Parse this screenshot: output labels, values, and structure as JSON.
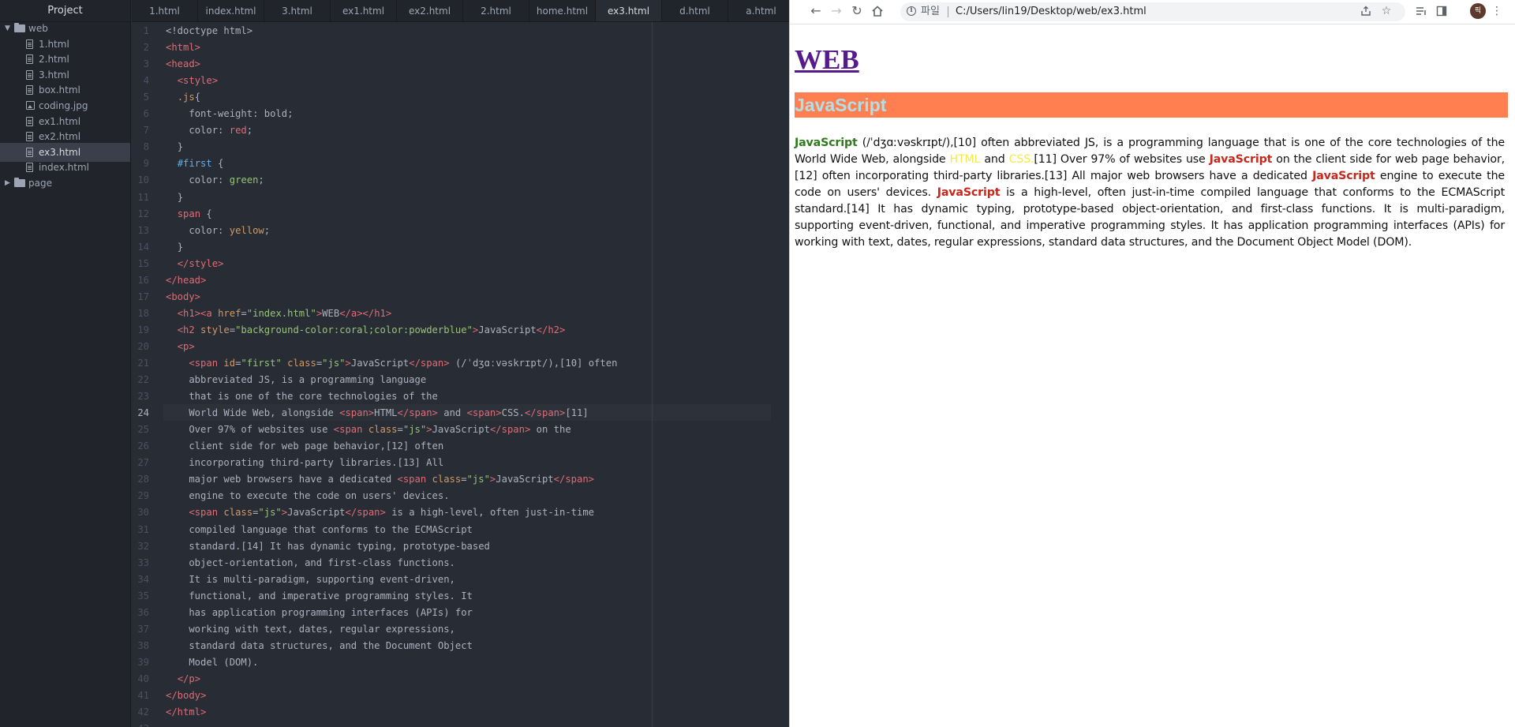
{
  "editor": {
    "project_title": "Project",
    "tree": [
      {
        "kind": "folder",
        "open": true,
        "label": "web",
        "depth": 0
      },
      {
        "kind": "file",
        "label": "1.html",
        "depth": 1
      },
      {
        "kind": "file",
        "label": "2.html",
        "depth": 1
      },
      {
        "kind": "file",
        "label": "3.html",
        "depth": 1
      },
      {
        "kind": "file",
        "label": "box.html",
        "depth": 1
      },
      {
        "kind": "image",
        "label": "coding.jpg",
        "depth": 1
      },
      {
        "kind": "file",
        "label": "ex1.html",
        "depth": 1
      },
      {
        "kind": "file",
        "label": "ex2.html",
        "depth": 1
      },
      {
        "kind": "file",
        "label": "ex3.html",
        "depth": 1,
        "selected": true
      },
      {
        "kind": "file",
        "label": "index.html",
        "depth": 1
      },
      {
        "kind": "folder",
        "open": false,
        "label": "page",
        "depth": 0
      }
    ],
    "tabs": [
      {
        "label": "1.html"
      },
      {
        "label": "index.html"
      },
      {
        "label": "3.html"
      },
      {
        "label": "ex1.html"
      },
      {
        "label": "ex2.html"
      },
      {
        "label": "2.html"
      },
      {
        "label": "home.html"
      },
      {
        "label": "ex3.html",
        "active": true
      },
      {
        "label": "d.html"
      },
      {
        "label": "a.html"
      }
    ],
    "current_line": 24,
    "code_lines": [
      [
        [
          "t-text",
          "<!doctype html>"
        ]
      ],
      [
        [
          "t-tag",
          "<html>"
        ]
      ],
      [
        [
          "t-tag",
          "<head>"
        ]
      ],
      [
        [
          "t-text",
          "  "
        ],
        [
          "t-tag",
          "<style>"
        ]
      ],
      [
        [
          "t-text",
          "  "
        ],
        [
          "t-sel",
          ".js"
        ],
        [
          "t-punct",
          "{"
        ]
      ],
      [
        [
          "t-text",
          "    "
        ],
        [
          "t-prop",
          "font-weight: bold;"
        ]
      ],
      [
        [
          "t-text",
          "    "
        ],
        [
          "t-prop",
          "color: "
        ],
        [
          "t-val",
          "red"
        ],
        [
          "t-punct",
          ";"
        ]
      ],
      [
        [
          "t-text",
          "  "
        ],
        [
          "t-punct",
          "}"
        ]
      ],
      [
        [
          "t-text",
          "  "
        ],
        [
          "t-id",
          "#first"
        ],
        [
          "t-punct",
          " {"
        ]
      ],
      [
        [
          "t-text",
          "    "
        ],
        [
          "t-prop",
          "color: "
        ],
        [
          "t-str",
          "green"
        ],
        [
          "t-punct",
          ";"
        ]
      ],
      [
        [
          "t-text",
          "  "
        ],
        [
          "t-punct",
          "}"
        ]
      ],
      [
        [
          "t-text",
          "  "
        ],
        [
          "t-tag",
          "span"
        ],
        [
          "t-punct",
          " {"
        ]
      ],
      [
        [
          "t-text",
          "    "
        ],
        [
          "t-prop",
          "color: "
        ],
        [
          "t-attr",
          "yellow"
        ],
        [
          "t-punct",
          ";"
        ]
      ],
      [
        [
          "t-text",
          "  "
        ],
        [
          "t-punct",
          "}"
        ]
      ],
      [
        [
          "t-text",
          "  "
        ],
        [
          "t-tag",
          "</style>"
        ]
      ],
      [
        [
          "t-tag",
          "</head>"
        ]
      ],
      [
        [
          "t-tag",
          "<body>"
        ]
      ],
      [
        [
          "t-text",
          "  "
        ],
        [
          "t-tag",
          "<h1><a "
        ],
        [
          "t-attr",
          "href"
        ],
        [
          "t-punct",
          "="
        ],
        [
          "t-str",
          "\"index.html\""
        ],
        [
          "t-tag",
          ">"
        ],
        [
          "t-text",
          "WEB"
        ],
        [
          "t-tag",
          "</a></h1>"
        ]
      ],
      [
        [
          "t-text",
          "  "
        ],
        [
          "t-tag",
          "<h2 "
        ],
        [
          "t-attr",
          "style"
        ],
        [
          "t-punct",
          "="
        ],
        [
          "t-str",
          "\"background-color:coral;color:powderblue\""
        ],
        [
          "t-tag",
          ">"
        ],
        [
          "t-text",
          "JavaScript"
        ],
        [
          "t-tag",
          "</h2>"
        ]
      ],
      [
        [
          "t-text",
          "  "
        ],
        [
          "t-tag",
          "<p>"
        ]
      ],
      [
        [
          "t-text",
          "    "
        ],
        [
          "t-tag",
          "<span "
        ],
        [
          "t-attr",
          "id"
        ],
        [
          "t-punct",
          "="
        ],
        [
          "t-str",
          "\"first\""
        ],
        [
          "t-attr",
          " class"
        ],
        [
          "t-punct",
          "="
        ],
        [
          "t-str",
          "\"js\""
        ],
        [
          "t-tag",
          ">"
        ],
        [
          "t-text",
          "JavaScript"
        ],
        [
          "t-tag",
          "</span>"
        ],
        [
          "t-text",
          " (/ˈdʒɑːvəskrɪpt/),[10] often"
        ]
      ],
      [
        [
          "t-text",
          "    abbreviated JS, is a programming language"
        ]
      ],
      [
        [
          "t-text",
          "    that is one of the core technologies of the"
        ]
      ],
      [
        [
          "t-text",
          "    World Wide Web, alongside "
        ],
        [
          "t-tag",
          "<span>"
        ],
        [
          "t-text",
          "HTML"
        ],
        [
          "t-tag",
          "</span>"
        ],
        [
          "t-text",
          " and "
        ],
        [
          "t-tag",
          "<span>"
        ],
        [
          "t-text",
          "CSS."
        ],
        [
          "t-tag",
          "</span>"
        ],
        [
          "t-text",
          "[11]"
        ]
      ],
      [
        [
          "t-text",
          "    Over 97% of websites use "
        ],
        [
          "t-tag",
          "<span "
        ],
        [
          "t-attr",
          "class"
        ],
        [
          "t-punct",
          "="
        ],
        [
          "t-str",
          "\"js\""
        ],
        [
          "t-tag",
          ">"
        ],
        [
          "t-text",
          "JavaScript"
        ],
        [
          "t-tag",
          "</span>"
        ],
        [
          "t-text",
          " on the"
        ]
      ],
      [
        [
          "t-text",
          "    client side for web page behavior,[12] often"
        ]
      ],
      [
        [
          "t-text",
          "    incorporating third-party libraries.[13] All"
        ]
      ],
      [
        [
          "t-text",
          "    major web browsers have a dedicated "
        ],
        [
          "t-tag",
          "<span "
        ],
        [
          "t-attr",
          "class"
        ],
        [
          "t-punct",
          "="
        ],
        [
          "t-str",
          "\"js\""
        ],
        [
          "t-tag",
          ">"
        ],
        [
          "t-text",
          "JavaScript"
        ],
        [
          "t-tag",
          "</span>"
        ]
      ],
      [
        [
          "t-text",
          "    engine to execute the code on users' devices."
        ]
      ],
      [
        [
          "t-text",
          "    "
        ],
        [
          "t-tag",
          "<span "
        ],
        [
          "t-attr",
          "class"
        ],
        [
          "t-punct",
          "="
        ],
        [
          "t-str",
          "\"js\""
        ],
        [
          "t-tag",
          ">"
        ],
        [
          "t-text",
          "JavaScript"
        ],
        [
          "t-tag",
          "</span>"
        ],
        [
          "t-text",
          " is a high-level, often just-in-time"
        ]
      ],
      [
        [
          "t-text",
          "    compiled language that conforms to the ECMAScript"
        ]
      ],
      [
        [
          "t-text",
          "    standard.[14] It has dynamic typing, prototype-based"
        ]
      ],
      [
        [
          "t-text",
          "    object-orientation, and first-class functions."
        ]
      ],
      [
        [
          "t-text",
          "    It is multi-paradigm, supporting event-driven,"
        ]
      ],
      [
        [
          "t-text",
          "    functional, and imperative programming styles. It"
        ]
      ],
      [
        [
          "t-text",
          "    has application programming interfaces (APIs) for"
        ]
      ],
      [
        [
          "t-text",
          "    working with text, dates, regular expressions,"
        ]
      ],
      [
        [
          "t-text",
          "    standard data structures, and the Document Object"
        ]
      ],
      [
        [
          "t-text",
          "    Model (DOM)."
        ]
      ],
      [
        [
          "t-text",
          "  "
        ],
        [
          "t-tag",
          "</p>"
        ]
      ],
      [
        [
          "t-tag",
          "</body>"
        ]
      ],
      [
        [
          "t-tag",
          "</html>"
        ]
      ],
      []
    ]
  },
  "browser": {
    "back_icon": "arrow-left-icon",
    "forward_icon": "arrow-right-icon",
    "reload_icon": "reload-icon",
    "home_icon": "home-icon",
    "scheme_label": "파일",
    "url": "C:/Users/lin19/Desktop/web/ex3.html",
    "avatar_letter": "픽",
    "page": {
      "h1_link": "WEB",
      "h2": "JavaScript",
      "paragraph": [
        {
          "t": "JavaScript",
          "c": "js first"
        },
        {
          "t": " (/ˈdʒɑːvəskrɪpt/),[10] often abbreviated JS, is a programming language that is one of the core technologies of the World Wide Web, alongside "
        },
        {
          "t": "HTML",
          "c": "yellow"
        },
        {
          "t": " and "
        },
        {
          "t": "CSS.",
          "c": "yellow"
        },
        {
          "t": "[11] Over 97% of websites use "
        },
        {
          "t": "JavaScript",
          "c": "js"
        },
        {
          "t": " on the client side for web page behavior,[12] often incorporating third-party libraries.[13] All major web browsers have a dedicated "
        },
        {
          "t": "JavaScript",
          "c": "js"
        },
        {
          "t": " engine to execute the code on users' devices. "
        },
        {
          "t": "JavaScript",
          "c": "js"
        },
        {
          "t": " is a high-level, often just-in-time compiled language that conforms to the ECMAScript standard.[14] It has dynamic typing, prototype-based object-orientation, and first-class functions. It is multi-paradigm, supporting event-driven, functional, and imperative programming styles. It has application programming interfaces (APIs) for working with text, dates, regular expressions, standard data structures, and the Document Object Model (DOM)."
        }
      ]
    }
  },
  "colors": {
    "editor_bg": "#282c34",
    "panel_bg": "#21252b",
    "h2_bg": "coral",
    "h2_fg": "powderblue",
    "js_red": "#c6281c",
    "first_green": "#2f7a1e"
  }
}
